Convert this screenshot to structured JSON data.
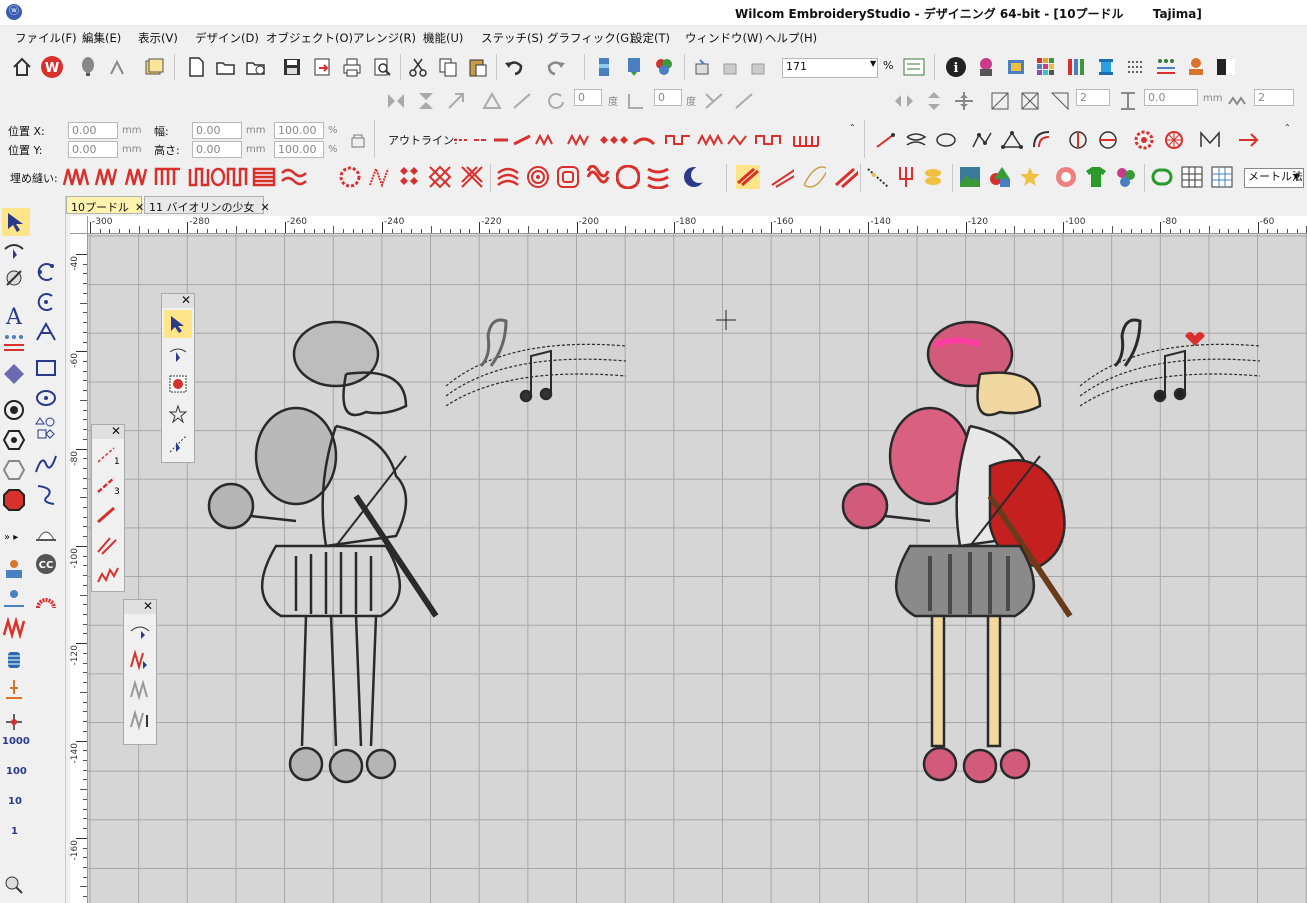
{
  "window": {
    "title": "Wilcom EmbroideryStudio - デザイニング 64-bit - [10プードル       Tajima]"
  },
  "menu": [
    "ファイル(F)",
    "編集(E)",
    "表示(V)",
    "デザイン(D)",
    "オブジェクト(O)",
    "アレンジ(R)",
    "機能(U)",
    "ステッチ(S)",
    "グラフィック(G)",
    "設定(T)",
    "ウィンドウ(W)",
    "ヘルプ(H)"
  ],
  "toolbar": {
    "zoom_value": "171",
    "zoom_unit": "%",
    "rotate_value1": "0",
    "rotate_unit1": "度",
    "rotate_value2": "0",
    "rotate_unit2": "度",
    "spacing_value1": "2",
    "spacing_value2": "0.0",
    "spacing_unit": "mm",
    "spacing_value3": "2"
  },
  "props": {
    "pos_x_label": "位置 X:",
    "pos_x_value": "0.00",
    "pos_y_label": "位置 Y:",
    "pos_y_value": "0.00",
    "width_label": "幅:",
    "width_value": "0.00",
    "height_label": "高さ:",
    "height_value": "0.00",
    "unit_mm": "mm",
    "scale_w": "100.00",
    "scale_h": "100.00",
    "pct": "%",
    "outline_label": "アウトライン:"
  },
  "fill": {
    "label": "埋め縫い:",
    "method_select": "メートル法"
  },
  "tabs": [
    {
      "label": "10プードル",
      "close": "✕"
    },
    {
      "label": "11 バイオリンの少女",
      "close": "✕"
    }
  ],
  "ruler_x": [
    "-300",
    "-280",
    "-260",
    "-240",
    "-220",
    "-200",
    "-180",
    "-160",
    "-140",
    "-120",
    "-100",
    "-80",
    "-60"
  ],
  "ruler_y": [
    "-40",
    "-60",
    "-80",
    "-100",
    "-120",
    "-140",
    "-160"
  ],
  "side_labels": [
    "1000",
    "100",
    "10",
    "1"
  ],
  "outline_panel_labels": [
    "1",
    "3"
  ],
  "panel_close": "✕",
  "colors": {
    "accent_red": "#d8302c",
    "accent_yellow": "#ffe48a",
    "canvas": "#d6d6d6",
    "grid": "#a8a8a8"
  },
  "icons": {
    "app": "wilcom-logo-icon",
    "home": "home-icon",
    "w": "wilcom-w-icon",
    "new": "new-file-icon",
    "open": "open-folder-icon",
    "save": "save-icon",
    "print": "print-icon",
    "cut": "scissors-icon",
    "copy": "copy-icon",
    "paste": "paste-icon",
    "undo": "undo-icon",
    "redo": "redo-icon",
    "info": "info-icon"
  }
}
